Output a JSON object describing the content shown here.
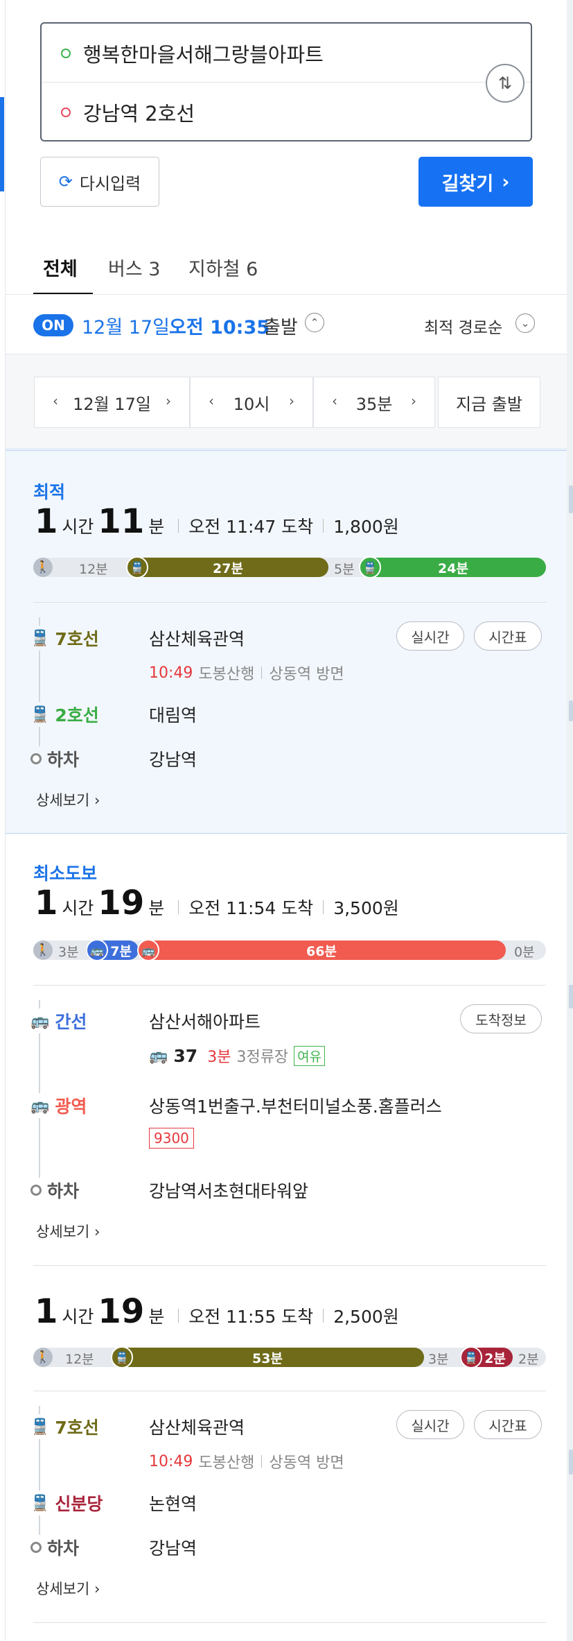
{
  "search": {
    "origin": "행복한마을서해그랑블아파트",
    "destination": "강남역 2호선",
    "reset_label": "다시입력",
    "go_label": "길찾기"
  },
  "tabs": [
    {
      "label": "전체"
    },
    {
      "label": "버스 3"
    },
    {
      "label": "지하철 6"
    }
  ],
  "options": {
    "badge": "ON",
    "date": "12월 17일",
    "time": "오전 10:35",
    "suffix": "출발",
    "sort": "최적 경로순"
  },
  "time_picker": {
    "date": "12월 17일",
    "hour": "10시",
    "minute": "35분",
    "now": "지금 출발"
  },
  "colors": {
    "line7": "#6f6b18",
    "line2": "#3aac45",
    "bus_blue": "#3d6fdc",
    "bus_red": "#f15b50",
    "sinbundang": "#a8243a",
    "accent": "#1a73e8"
  },
  "routes": [
    {
      "label": "최적",
      "hours": "1",
      "hour_unit": "시간",
      "minutes": "11",
      "min_unit": "분",
      "arrival": "오전 11:47 도착",
      "fare": "1,800원",
      "bar": {
        "walk": "12분",
        "seg1": "27분",
        "gap": "5분",
        "seg2": "24분"
      },
      "legs": [
        {
          "type": "7호선",
          "stop": "삼산체육관역",
          "time": "10:49",
          "dir1": "도봉산행",
          "dir2": "상동역 방면",
          "btn1": "실시간",
          "btn2": "시간표"
        },
        {
          "type": "2호선",
          "stop": "대림역"
        },
        {
          "type": "하차",
          "stop": "강남역"
        }
      ],
      "detail": "상세보기"
    },
    {
      "label": "최소도보",
      "hours": "1",
      "hour_unit": "시간",
      "minutes": "19",
      "min_unit": "분",
      "arrival": "오전 11:54 도착",
      "fare": "3,500원",
      "bar": {
        "walk": "3분",
        "seg1": "7분",
        "seg2": "66분",
        "end": "0분"
      },
      "legs": [
        {
          "type": "간선",
          "stop": "삼산서해아파트",
          "bus": "37",
          "eta": "3분",
          "stops": "3정류장",
          "crowd": "여유",
          "btn1": "도착정보"
        },
        {
          "type": "광역",
          "stop": "상동역1번출구.부천터미널소풍.홈플러스",
          "bus": "9300"
        },
        {
          "type": "하차",
          "stop": "강남역서초현대타워앞"
        }
      ],
      "detail": "상세보기"
    },
    {
      "hours": "1",
      "hour_unit": "시간",
      "minutes": "19",
      "min_unit": "분",
      "arrival": "오전 11:55 도착",
      "fare": "2,500원",
      "bar": {
        "walk": "12분",
        "seg1": "53분",
        "gap": "3분",
        "seg2": "2분",
        "end": "2분"
      },
      "legs": [
        {
          "type": "7호선",
          "stop": "삼산체육관역",
          "time": "10:49",
          "dir1": "도봉산행",
          "dir2": "상동역 방면",
          "btn1": "실시간",
          "btn2": "시간표"
        },
        {
          "type": "신분당",
          "stop": "논현역"
        },
        {
          "type": "하차",
          "stop": "강남역"
        }
      ],
      "detail": "상세보기"
    }
  ]
}
